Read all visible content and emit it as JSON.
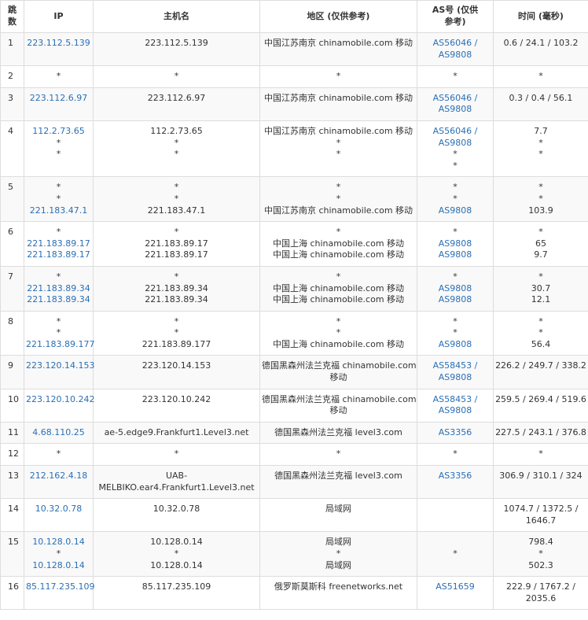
{
  "headers": {
    "hop": "跳数",
    "ip": "IP",
    "host": "主机名",
    "region": "地区 (仅供参考)",
    "as": "AS号 (仅供参考)",
    "time": "时间 (毫秒)"
  },
  "rows": [
    {
      "hop": "1",
      "ip": [
        "223.112.5.139"
      ],
      "host": [
        "223.112.5.139"
      ],
      "region": [
        "中国江苏南京 chinamobile.com 移动"
      ],
      "as": [
        "AS56046 /",
        "AS9808"
      ],
      "time": [
        "0.6 / 24.1 / 103.2"
      ]
    },
    {
      "hop": "2",
      "ip": [
        "*"
      ],
      "host": [
        "*"
      ],
      "region": [
        "*"
      ],
      "as": [
        "*"
      ],
      "time": [
        "*"
      ]
    },
    {
      "hop": "3",
      "ip": [
        "223.112.6.97"
      ],
      "host": [
        "223.112.6.97"
      ],
      "region": [
        "中国江苏南京 chinamobile.com 移动"
      ],
      "as": [
        "AS56046 /",
        "AS9808"
      ],
      "time": [
        "0.3 / 0.4 / 56.1"
      ]
    },
    {
      "hop": "4",
      "ip": [
        "112.2.73.65",
        "*",
        "*"
      ],
      "host": [
        "112.2.73.65",
        "*",
        "*"
      ],
      "region": [
        "中国江苏南京 chinamobile.com 移动",
        "*",
        "*"
      ],
      "as": [
        "AS56046 /",
        "AS9808",
        "*",
        "*"
      ],
      "time": [
        "7.7",
        "*",
        "*"
      ]
    },
    {
      "hop": "5",
      "ip": [
        "*",
        "*",
        "221.183.47.1"
      ],
      "host": [
        "*",
        "*",
        "221.183.47.1"
      ],
      "region": [
        "*",
        "*",
        "中国江苏南京 chinamobile.com 移动"
      ],
      "as": [
        "*",
        "*",
        "AS9808"
      ],
      "time": [
        "*",
        "*",
        "103.9"
      ]
    },
    {
      "hop": "6",
      "ip": [
        "*",
        "221.183.89.17",
        "221.183.89.17"
      ],
      "host": [
        "*",
        "221.183.89.17",
        "221.183.89.17"
      ],
      "region": [
        "*",
        "中国上海 chinamobile.com 移动",
        "中国上海 chinamobile.com 移动"
      ],
      "as": [
        "*",
        "AS9808",
        "AS9808"
      ],
      "time": [
        "*",
        "65",
        "9.7"
      ]
    },
    {
      "hop": "7",
      "ip": [
        "*",
        "221.183.89.34",
        "221.183.89.34"
      ],
      "host": [
        "*",
        "221.183.89.34",
        "221.183.89.34"
      ],
      "region": [
        "*",
        "中国上海 chinamobile.com 移动",
        "中国上海 chinamobile.com 移动"
      ],
      "as": [
        "*",
        "AS9808",
        "AS9808"
      ],
      "time": [
        "*",
        "30.7",
        "12.1"
      ]
    },
    {
      "hop": "8",
      "ip": [
        "*",
        "*",
        "221.183.89.177"
      ],
      "host": [
        "*",
        "*",
        "221.183.89.177"
      ],
      "region": [
        "*",
        "*",
        "中国上海 chinamobile.com 移动"
      ],
      "as": [
        "*",
        "*",
        "AS9808"
      ],
      "time": [
        "*",
        "*",
        "56.4"
      ]
    },
    {
      "hop": "9",
      "ip": [
        "223.120.14.153"
      ],
      "host": [
        "223.120.14.153"
      ],
      "region": [
        "德国黑森州法兰克福 chinamobile.com",
        "移动"
      ],
      "as": [
        "AS58453 /",
        "AS9808"
      ],
      "time": [
        "226.2 / 249.7 / 338.2"
      ]
    },
    {
      "hop": "10",
      "ip": [
        "223.120.10.242"
      ],
      "host": [
        "223.120.10.242"
      ],
      "region": [
        "德国黑森州法兰克福 chinamobile.com",
        "移动"
      ],
      "as": [
        "AS58453 /",
        "AS9808"
      ],
      "time": [
        "259.5 / 269.4 / 519.6"
      ]
    },
    {
      "hop": "11",
      "ip": [
        "4.68.110.25"
      ],
      "host": [
        "ae-5.edge9.Frankfurt1.Level3.net"
      ],
      "region": [
        "德国黑森州法兰克福 level3.com"
      ],
      "as": [
        "AS3356"
      ],
      "time": [
        "227.5 / 243.1 / 376.8"
      ]
    },
    {
      "hop": "12",
      "ip": [
        "*"
      ],
      "host": [
        "*"
      ],
      "region": [
        "*"
      ],
      "as": [
        "*"
      ],
      "time": [
        "*"
      ]
    },
    {
      "hop": "13",
      "ip": [
        "212.162.4.18"
      ],
      "host": [
        "UAB-",
        "MELBIKO.ear4.Frankfurt1.Level3.net"
      ],
      "region": [
        "德国黑森州法兰克福 level3.com"
      ],
      "as": [
        "AS3356"
      ],
      "time": [
        "306.9 / 310.1 / 324"
      ]
    },
    {
      "hop": "14",
      "ip": [
        "10.32.0.78"
      ],
      "host": [
        "10.32.0.78"
      ],
      "region": [
        "局域网"
      ],
      "as": [],
      "time": [
        "1074.7 / 1372.5 /",
        "1646.7"
      ]
    },
    {
      "hop": "15",
      "ip": [
        "10.128.0.14",
        "*",
        "10.128.0.14"
      ],
      "host": [
        "10.128.0.14",
        "*",
        "10.128.0.14"
      ],
      "region": [
        "局域网",
        "*",
        "局域网"
      ],
      "as": [
        "",
        "*",
        ""
      ],
      "time": [
        "798.4",
        "*",
        "502.3"
      ]
    },
    {
      "hop": "16",
      "ip": [
        "85.117.235.109"
      ],
      "host": [
        "85.117.235.109"
      ],
      "region": [
        "俄罗斯莫斯科 freenetworks.net"
      ],
      "as": [
        "AS51659"
      ],
      "time": [
        "222.9 / 1767.2 /",
        "2035.6"
      ]
    }
  ]
}
